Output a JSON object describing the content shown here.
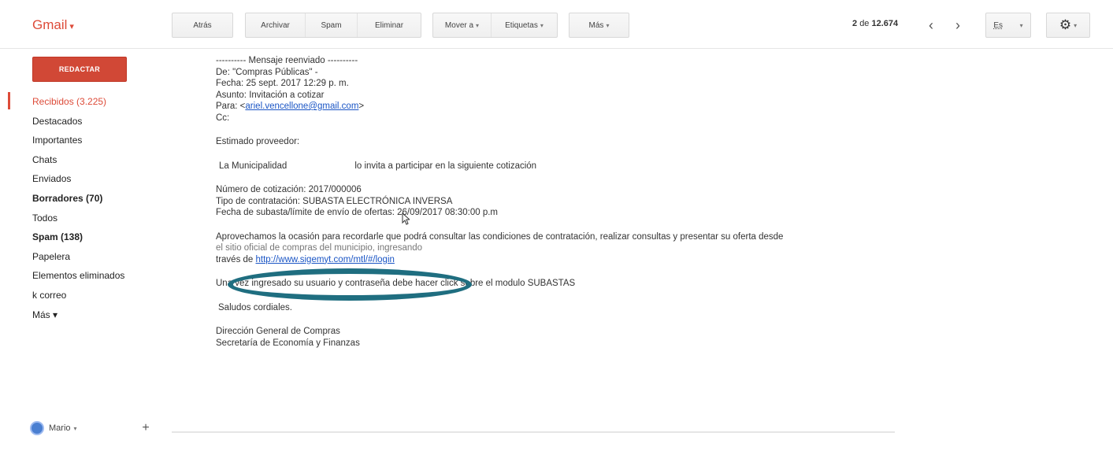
{
  "app": {
    "logo": "Gmail",
    "logo_caret": "▾"
  },
  "toolbar": {
    "back": "Atrás",
    "archive": "Archivar",
    "spam": "Spam",
    "delete": "Eliminar",
    "move_to": "Mover a",
    "labels": "Etiquetas",
    "more": "Más",
    "dropdown_caret": "▾"
  },
  "pagination": {
    "current": "2",
    "of": "de",
    "total": "12.674",
    "prev_icon": "‹",
    "next_icon": "›"
  },
  "language": {
    "value": "Es"
  },
  "settings": {
    "icon": "⚙",
    "caret": "▾"
  },
  "sidebar": {
    "compose": "REDACTAR",
    "items": [
      {
        "label": "Recibidos (3.225)"
      },
      {
        "label": "Destacados"
      },
      {
        "label": "Importantes"
      },
      {
        "label": "Chats"
      },
      {
        "label": "Enviados"
      },
      {
        "label": "Borradores (70)"
      },
      {
        "label": "Todos"
      },
      {
        "label": "Spam (138)"
      },
      {
        "label": "Papelera"
      },
      {
        "label": "Elementos eliminados"
      },
      {
        "label": "k correo"
      },
      {
        "label": "Más ▾"
      }
    ]
  },
  "user": {
    "name": "Mario",
    "caret": "▾",
    "add": "+"
  },
  "message": {
    "forward_header": "---------- Mensaje reenviado ----------",
    "from": "De: \"Compras Públicas\" -",
    "date": "Fecha: 25 sept. 2017 12:29 p. m.",
    "subject": "Asunto: Invitación a cotizar",
    "to_prefix": "Para: <",
    "to_email": "ariel.vencellone@gmail.com",
    "to_suffix": ">",
    "cc": "Cc:",
    "greeting": "Estimado proveedor:",
    "intro_a": "La Municipalidad",
    "intro_b": "lo invita a participar en la siguiente cotización",
    "quote_number": "Número de cotización: 2017/000006",
    "contract_type": "Tipo de contratación: SUBASTA ELECTRÓNICA INVERSA",
    "deadline": "Fecha de subasta/límite de envío de ofertas: 26/09/2017 08:30:00 p.m",
    "body_1": "Aprovechamos la ocasión para recordarle que podrá consultar las condiciones de contratación, realizar consultas y presentar su oferta desde",
    "body_2": "el sitio oficial de compras del municipio, ingresando",
    "body_3_prefix": "través de ",
    "link": "http://www.sigemyt.com/mtl/#/login",
    "body_4": "Una vez ingresado su usuario y contraseña debe hacer click sobre el modulo SUBASTAS",
    "closing": "Saludos cordiales.",
    "sig_1": "Dirección General de Compras",
    "sig_2": "Secretaría de Economía y Finanzas"
  },
  "colors": {
    "accent": "#dd4b39",
    "compose_bg": "#d14836",
    "link": "#1a55c5",
    "highlight": "#1f6e80"
  }
}
